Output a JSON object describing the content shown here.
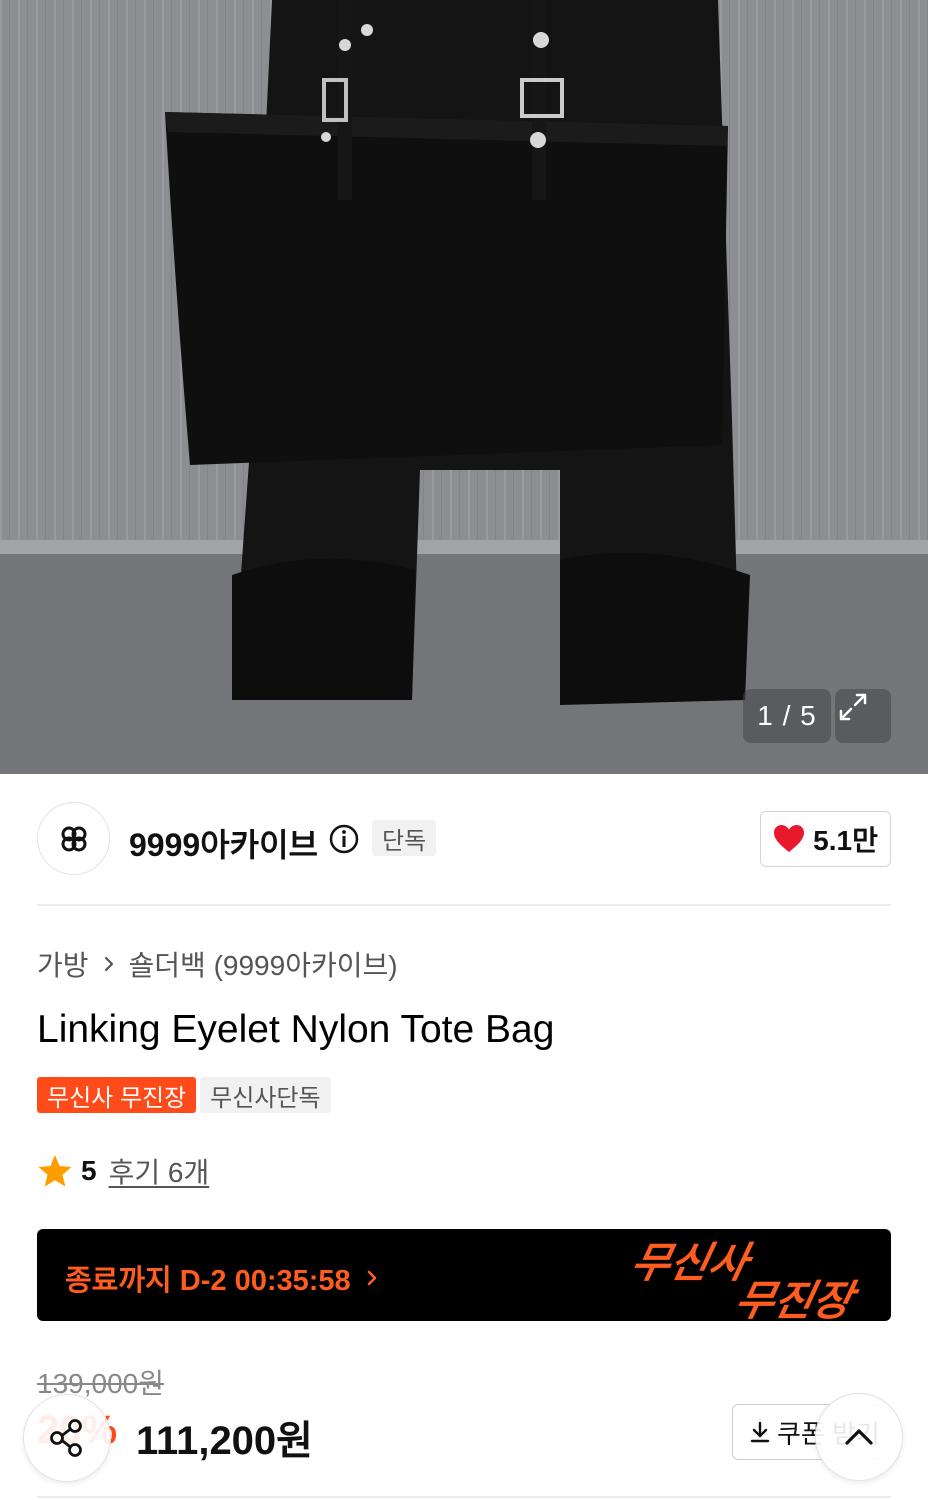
{
  "gallery": {
    "counter": "1 / 5",
    "current_index": 1,
    "total_images": 5
  },
  "brand": {
    "name": "9999아카이브",
    "exclusive_label": "단독",
    "like_count": "5.1만"
  },
  "product": {
    "breadcrumb": [
      "가방",
      "숄더백 (9999아카이브)"
    ],
    "title": "Linking Eyelet Nylon Tote Bag",
    "tags": [
      "무신사 무진장",
      "무신사단독"
    ],
    "rating": "5",
    "review_link": "후기 6개"
  },
  "banner": {
    "countdown": "종료까지 D-2 00:35:58",
    "logo_line1": "무신사",
    "logo_line2": "무진장"
  },
  "price": {
    "original": "139,000원",
    "discount": "20%",
    "sale": "111,200원",
    "coupon_label": "쿠폰 받기"
  },
  "colors": {
    "accent_orange": "#ff4b1a",
    "heart_red": "#e8192c",
    "star_orange": "#ff9d00"
  },
  "icons": [
    "expand-icon",
    "info-icon",
    "heart-icon",
    "chevron-right-icon",
    "star-icon",
    "download-icon",
    "share-icon",
    "chevron-up-icon"
  ]
}
